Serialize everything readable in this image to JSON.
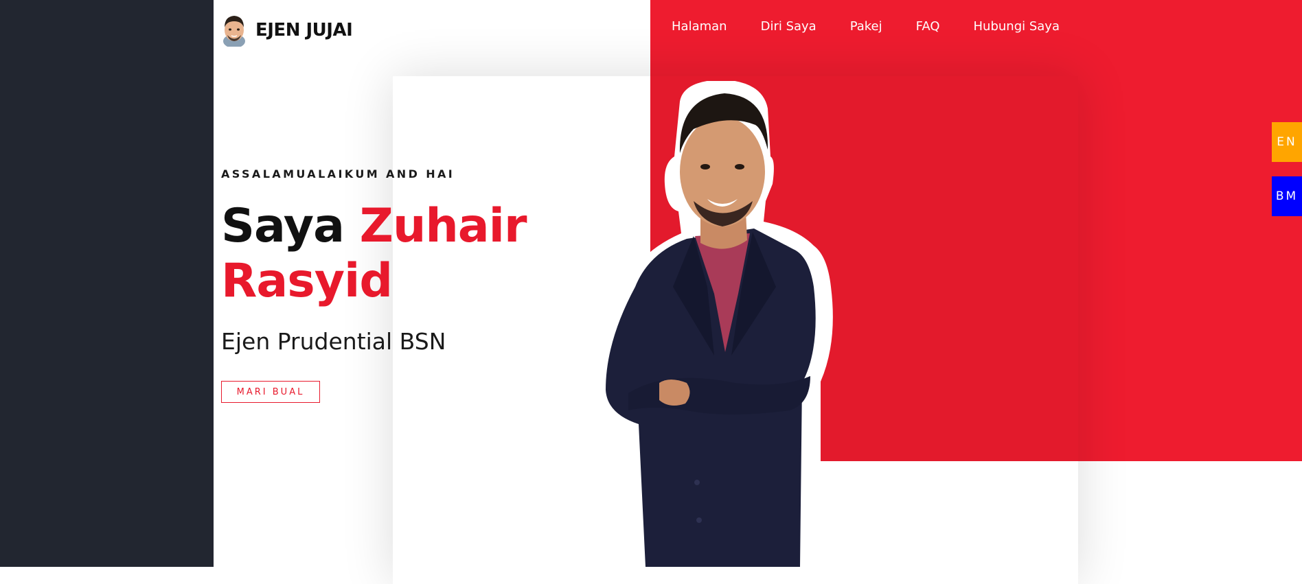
{
  "brand": {
    "name": "EJEN JUJAI",
    "avatar_icon": "cartoon-avatar-icon"
  },
  "nav": {
    "items": [
      "Halaman",
      "Diri Saya",
      "Pakej",
      "FAQ",
      "Hubungi Saya"
    ]
  },
  "language": {
    "en": "EN",
    "bm": "BM"
  },
  "hero": {
    "greeting": "ASSALAMUALAIKUM AND HAI",
    "title_prefix": "Saya",
    "title_name_line1": "Zuhair",
    "title_name_line2": "Rasyid",
    "subtitle": "Ejen Prudential BSN",
    "cta_label": "MARI BUAL"
  },
  "colors": {
    "accent_red": "#ee1c2f",
    "sidebar_dark": "#222630",
    "lang_en": "#ffa500",
    "lang_bm": "#0000ff"
  }
}
